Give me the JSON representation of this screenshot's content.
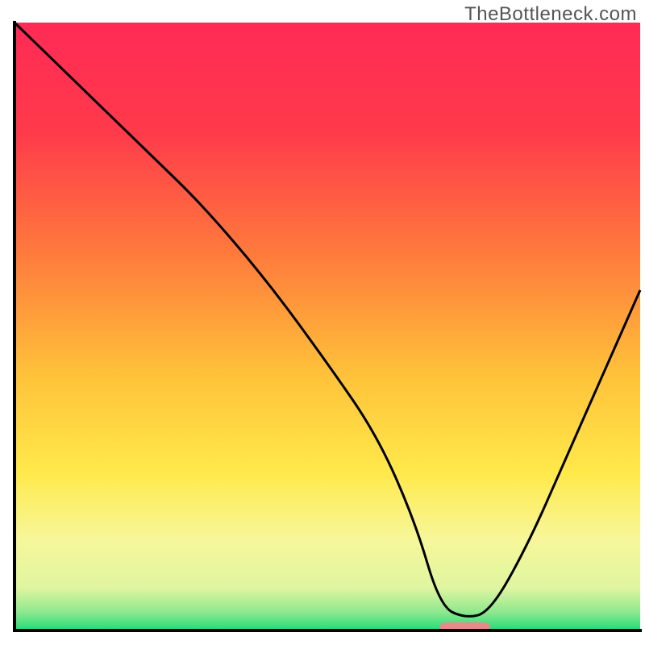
{
  "watermark": "TheBottleneck.com",
  "chart_data": {
    "type": "line",
    "title": "",
    "xlabel": "",
    "ylabel": "",
    "xlim": [
      0,
      100
    ],
    "ylim": [
      0,
      100
    ],
    "background_gradient": {
      "stops": [
        {
          "offset": 0.0,
          "color": "#ff2a55"
        },
        {
          "offset": 0.18,
          "color": "#ff3a4b"
        },
        {
          "offset": 0.38,
          "color": "#ff7a3c"
        },
        {
          "offset": 0.58,
          "color": "#ffc23a"
        },
        {
          "offset": 0.74,
          "color": "#ffe94a"
        },
        {
          "offset": 0.85,
          "color": "#f7f79a"
        },
        {
          "offset": 0.93,
          "color": "#dff5a0"
        },
        {
          "offset": 0.97,
          "color": "#8ee88e"
        },
        {
          "offset": 1.0,
          "color": "#1fdc7a"
        }
      ]
    },
    "optimal_marker": {
      "x_start": 68,
      "x_end": 76,
      "color": "#e88a8a"
    },
    "curve": {
      "x": [
        0,
        8,
        22,
        30,
        40,
        50,
        58,
        64,
        68,
        72,
        76,
        82,
        88,
        94,
        100
      ],
      "y": [
        100,
        92,
        78,
        70,
        58,
        44,
        32,
        18,
        4,
        2,
        3,
        14,
        28,
        42,
        56
      ]
    }
  }
}
